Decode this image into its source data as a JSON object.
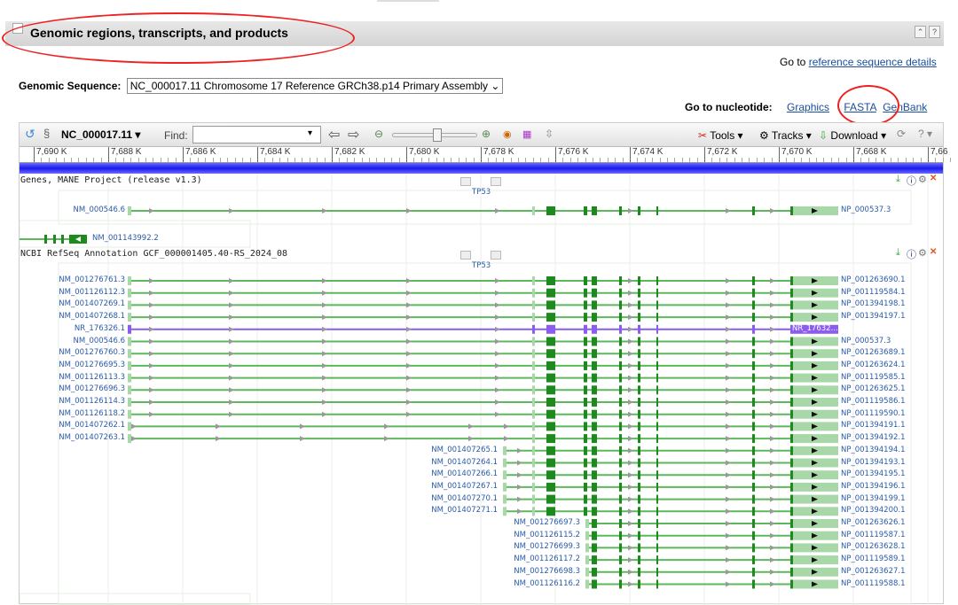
{
  "section": {
    "title": "Genomic regions, transcripts, and products"
  },
  "goto_ref": {
    "prefix": "Go to",
    "link": "reference sequence details"
  },
  "genomic_sequence": {
    "label": "Genomic Sequence:",
    "value": "NC_000017.11 Chromosome 17 Reference GRCh38.p14 Primary Assembly"
  },
  "goto_nucleotide": {
    "label": "Go to nucleotide:",
    "links": [
      "Graphics",
      "FASTA",
      "GenBank"
    ]
  },
  "toolbar": {
    "accession": "NC_000017.11",
    "find_label": "Find:",
    "find_value": "",
    "tools": "Tools",
    "tracks": "Tracks",
    "download": "Download"
  },
  "ruler": [
    "7,690 K",
    "7,688 K",
    "7,686 K",
    "7,684 K",
    "7,682 K",
    "7,680 K",
    "7,678 K",
    "7,676 K",
    "7,674 K",
    "7,672 K",
    "7,670 K",
    "7,668 K",
    "7,66"
  ],
  "tracks": [
    {
      "title": "Genes, MANE Project (release v1.3)",
      "gene": "TP53",
      "rows": [
        {
          "nm": "NM_000546.6",
          "np": "NP_000537.3"
        }
      ],
      "extra": "NM_001143992.2"
    },
    {
      "title": "NCBI RefSeq Annotation GCF_000001405.40-RS_2024_08",
      "gene": "TP53",
      "rows": [
        {
          "nm": "NM_001276761.3",
          "np": "NP_001263690.1",
          "type": "full"
        },
        {
          "nm": "NM_001126112.3",
          "np": "NP_001119584.1",
          "type": "full"
        },
        {
          "nm": "NM_001407269.1",
          "np": "NP_001394198.1",
          "type": "full"
        },
        {
          "nm": "NM_001407268.1",
          "np": "NP_001394197.1",
          "type": "full"
        },
        {
          "nm": "NR_176326.1",
          "np": "NR_17632...",
          "type": "noncoding"
        },
        {
          "nm": "NM_000546.6",
          "np": "NP_000537.3",
          "type": "full"
        },
        {
          "nm": "NM_001276760.3",
          "np": "NP_001263689.1",
          "type": "full"
        },
        {
          "nm": "NM_001276695.3",
          "np": "NP_001263624.1",
          "type": "full"
        },
        {
          "nm": "NM_001126113.3",
          "np": "NP_001119585.1",
          "type": "full"
        },
        {
          "nm": "NM_001276696.3",
          "np": "NP_001263625.1",
          "type": "full"
        },
        {
          "nm": "NM_001126114.3",
          "np": "NP_001119586.1",
          "type": "full"
        },
        {
          "nm": "NM_001126118.2",
          "np": "NP_001119590.1",
          "type": "full"
        },
        {
          "nm": "NM_001407262.1",
          "np": "NP_001394191.1",
          "type": "alt"
        },
        {
          "nm": "NM_001407263.1",
          "np": "NP_001394192.1",
          "type": "alt"
        },
        {
          "nm": "NM_001407265.1",
          "np": "NP_001394194.1",
          "type": "mid"
        },
        {
          "nm": "NM_001407264.1",
          "np": "NP_001394193.1",
          "type": "mid"
        },
        {
          "nm": "NM_001407266.1",
          "np": "NP_001394195.1",
          "type": "mid"
        },
        {
          "nm": "NM_001407267.1",
          "np": "NP_001394196.1",
          "type": "mid"
        },
        {
          "nm": "NM_001407270.1",
          "np": "NP_001394199.1",
          "type": "mid"
        },
        {
          "nm": "NM_001407271.1",
          "np": "NP_001394200.1",
          "type": "mid"
        },
        {
          "nm": "NM_001276697.3",
          "np": "NP_001263626.1",
          "type": "short"
        },
        {
          "nm": "NM_001126115.2",
          "np": "NP_001119587.1",
          "type": "short"
        },
        {
          "nm": "NM_001276699.3",
          "np": "NP_001263628.1",
          "type": "short"
        },
        {
          "nm": "NM_001126117.2",
          "np": "NP_001119589.1",
          "type": "short"
        },
        {
          "nm": "NM_001276698.3",
          "np": "NP_001263627.1",
          "type": "short"
        },
        {
          "nm": "NM_001126116.2",
          "np": "NP_001119588.1",
          "type": "short"
        }
      ]
    }
  ],
  "colors": {
    "coding": "#1e8a1e",
    "utr": "#a8d8a8",
    "intron": "#5cb85c",
    "noncoding": "#8a5cf0",
    "annotation": "#e22222",
    "link": "#1a4ea0"
  }
}
